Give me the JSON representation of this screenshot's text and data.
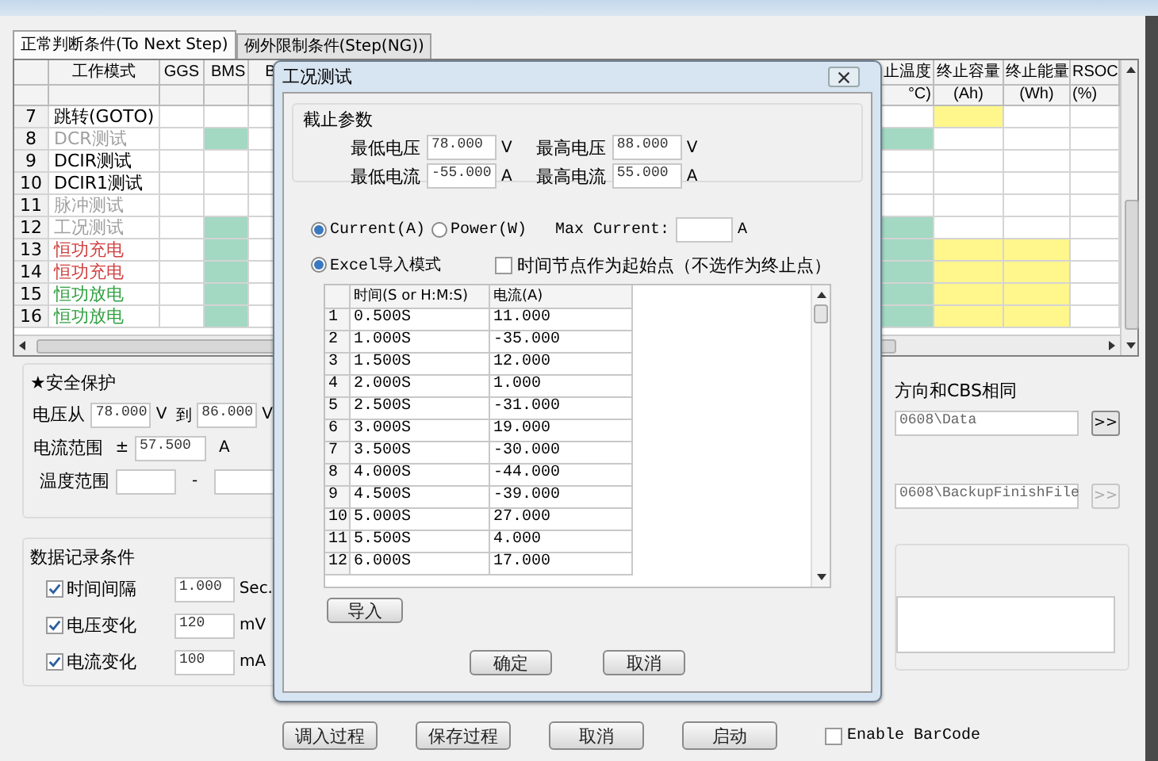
{
  "window": {
    "tabs": [
      {
        "label": "正常判断条件(To Next Step)",
        "selected": true
      },
      {
        "label": "例外限制条件(Step(NG))",
        "selected": false
      }
    ]
  },
  "grid": {
    "columns": [
      {
        "label": "工作模式"
      },
      {
        "label": "GGS"
      },
      {
        "label": "BMS"
      },
      {
        "label": "B"
      },
      {
        "label": "止温度",
        "unit": "°C)"
      },
      {
        "label": "终止容量",
        "unit": "(Ah)"
      },
      {
        "label": "终止能量",
        "unit": "(Wh)"
      },
      {
        "label": "RSOC",
        "unit": "(%)"
      }
    ],
    "rows": [
      {
        "number": "7",
        "mode": "跳转(GOTO)",
        "color": "#000000",
        "cells": [
          {
            "filled": false
          },
          {
            "filled": false
          },
          {
            "filled": false
          },
          {
            "filled": false
          },
          {
            "filled": true,
            "color": "#fff68c"
          },
          {
            "filled": false
          },
          {
            "filled": false
          }
        ]
      },
      {
        "number": "8",
        "mode": "DCR测试",
        "color": "#a0a0a0",
        "cells": [
          {
            "filled": false
          },
          {
            "filled": true,
            "color": "#a3d8c3"
          },
          {
            "filled": false
          },
          {
            "filled": true,
            "color": "#a3d8c3"
          },
          {
            "filled": false
          },
          {
            "filled": false
          },
          {
            "filled": false
          }
        ]
      },
      {
        "number": "9",
        "mode": "DCIR测试",
        "color": "#000000",
        "cells": [
          {
            "filled": false
          },
          {
            "filled": false
          },
          {
            "filled": false
          },
          {
            "filled": false
          },
          {
            "filled": false
          },
          {
            "filled": false
          },
          {
            "filled": false
          }
        ]
      },
      {
        "number": "10",
        "mode": "DCIR1测试",
        "color": "#000000",
        "cells": [
          {
            "filled": false
          },
          {
            "filled": false
          },
          {
            "filled": false
          },
          {
            "filled": false
          },
          {
            "filled": false
          },
          {
            "filled": false
          },
          {
            "filled": false
          }
        ]
      },
      {
        "number": "11",
        "mode": "脉冲测试",
        "color": "#a0a0a0",
        "cells": [
          {
            "filled": false
          },
          {
            "filled": false
          },
          {
            "filled": false
          },
          {
            "filled": false
          },
          {
            "filled": false
          },
          {
            "filled": false
          },
          {
            "filled": false
          }
        ]
      },
      {
        "number": "12",
        "mode": "工况测试",
        "color": "#a0a0a0",
        "cells": [
          {
            "filled": false
          },
          {
            "filled": true,
            "color": "#a3d8c3"
          },
          {
            "filled": false
          },
          {
            "filled": true,
            "color": "#a3d8c3"
          },
          {
            "filled": false
          },
          {
            "filled": false
          },
          {
            "filled": false
          }
        ]
      },
      {
        "number": "13",
        "mode": "恒功充电",
        "color": "#d04040",
        "cells": [
          {
            "filled": false
          },
          {
            "filled": true,
            "color": "#a3d8c3"
          },
          {
            "filled": false
          },
          {
            "filled": true,
            "color": "#a3d8c3"
          },
          {
            "filled": true,
            "color": "#fff68c"
          },
          {
            "filled": true,
            "color": "#fff68c"
          },
          {
            "filled": false
          }
        ]
      },
      {
        "number": "14",
        "mode": "恒功充电",
        "color": "#d04040",
        "cells": [
          {
            "filled": false
          },
          {
            "filled": true,
            "color": "#a3d8c3"
          },
          {
            "filled": false
          },
          {
            "filled": true,
            "color": "#a3d8c3"
          },
          {
            "filled": true,
            "color": "#fff68c"
          },
          {
            "filled": true,
            "color": "#fff68c"
          },
          {
            "filled": false
          }
        ]
      },
      {
        "number": "15",
        "mode": "恒功放电",
        "color": "#30a040",
        "cells": [
          {
            "filled": false
          },
          {
            "filled": true,
            "color": "#a3d8c3"
          },
          {
            "filled": false
          },
          {
            "filled": true,
            "color": "#a3d8c3"
          },
          {
            "filled": true,
            "color": "#fff68c"
          },
          {
            "filled": true,
            "color": "#fff68c"
          },
          {
            "filled": false
          }
        ]
      },
      {
        "number": "16",
        "mode": "恒功放电",
        "color": "#30a040",
        "cells": [
          {
            "filled": false
          },
          {
            "filled": true,
            "color": "#a3d8c3"
          },
          {
            "filled": false
          },
          {
            "filled": true,
            "color": "#a3d8c3"
          },
          {
            "filled": true,
            "color": "#fff68c"
          },
          {
            "filled": true,
            "color": "#fff68c"
          },
          {
            "filled": false
          }
        ]
      }
    ]
  },
  "safety": {
    "title": "★安全保护",
    "voltage": {
      "label": "电压从",
      "from": "78.000",
      "unit_from": "V",
      "to_label": "到",
      "to": "86.000",
      "unit_to": "V"
    },
    "current": {
      "label": "电流范围",
      "sign": "±",
      "value": "57.500",
      "unit": "A"
    },
    "temperature": {
      "label": "温度范围",
      "separator": "-"
    }
  },
  "record": {
    "title": "数据记录条件",
    "items": [
      {
        "label": "时间间隔",
        "checked": true,
        "value": "1.000",
        "unit": "Sec."
      },
      {
        "label": "电压变化",
        "checked": true,
        "value": "120",
        "unit": "mV"
      },
      {
        "label": "电流变化",
        "checked": true,
        "value": "100",
        "unit": "mA"
      }
    ]
  },
  "paths": {
    "note": "方向和CBS相同",
    "items": [
      {
        "value": "0608\\Data",
        "button": ">>",
        "disabled": false
      },
      {
        "value": "0608\\BackupFinishFile",
        "button": ">>",
        "disabled": true
      }
    ]
  },
  "buttons": [
    "调入过程",
    "保存过程",
    "取消",
    "启动"
  ],
  "barcode": {
    "label": "Enable BarCode",
    "checked": false
  },
  "dialog": {
    "title": "工况测试",
    "cutoff": {
      "title": "截止参数",
      "fields": [
        {
          "label": "最低电压",
          "value": "78.000",
          "unit": "V"
        },
        {
          "label": "最高电压",
          "value": "88.000",
          "unit": "V"
        },
        {
          "label": "最低电流",
          "value": "-55.000",
          "unit": "A"
        },
        {
          "label": "最高电流",
          "value": "55.000",
          "unit": "A"
        }
      ]
    },
    "modes": [
      {
        "label": "Current(A)",
        "selected": true
      },
      {
        "label": "Power(W)",
        "selected": false
      }
    ],
    "max_current": {
      "label": "Max Current:",
      "unit": "A"
    },
    "excel": {
      "label": "Excel导入模式",
      "selected": true
    },
    "time_start": {
      "label": "时间节点作为起始点（不选作为终止点）",
      "checked": false
    },
    "table": {
      "columns": [
        "时间(S or H:M:S)",
        "电流(A)"
      ],
      "rows": [
        {
          "number": "1",
          "values": [
            "0.500S",
            "11.000"
          ]
        },
        {
          "number": "2",
          "values": [
            "1.000S",
            "-35.000"
          ]
        },
        {
          "number": "3",
          "values": [
            "1.500S",
            "12.000"
          ]
        },
        {
          "number": "4",
          "values": [
            "2.000S",
            "1.000"
          ]
        },
        {
          "number": "5",
          "values": [
            "2.500S",
            "-31.000"
          ]
        },
        {
          "number": "6",
          "values": [
            "3.000S",
            "19.000"
          ]
        },
        {
          "number": "7",
          "values": [
            "3.500S",
            "-30.000"
          ]
        },
        {
          "number": "8",
          "values": [
            "4.000S",
            "-44.000"
          ]
        },
        {
          "number": "9",
          "values": [
            "4.500S",
            "-39.000"
          ]
        },
        {
          "number": "10",
          "values": [
            "5.000S",
            "27.000"
          ]
        },
        {
          "number": "11",
          "values": [
            "5.500S",
            "4.000"
          ]
        },
        {
          "number": "12",
          "values": [
            "6.000S",
            "17.000"
          ]
        }
      ]
    },
    "import_button": "导入",
    "buttons": [
      "确定",
      "取消"
    ]
  }
}
